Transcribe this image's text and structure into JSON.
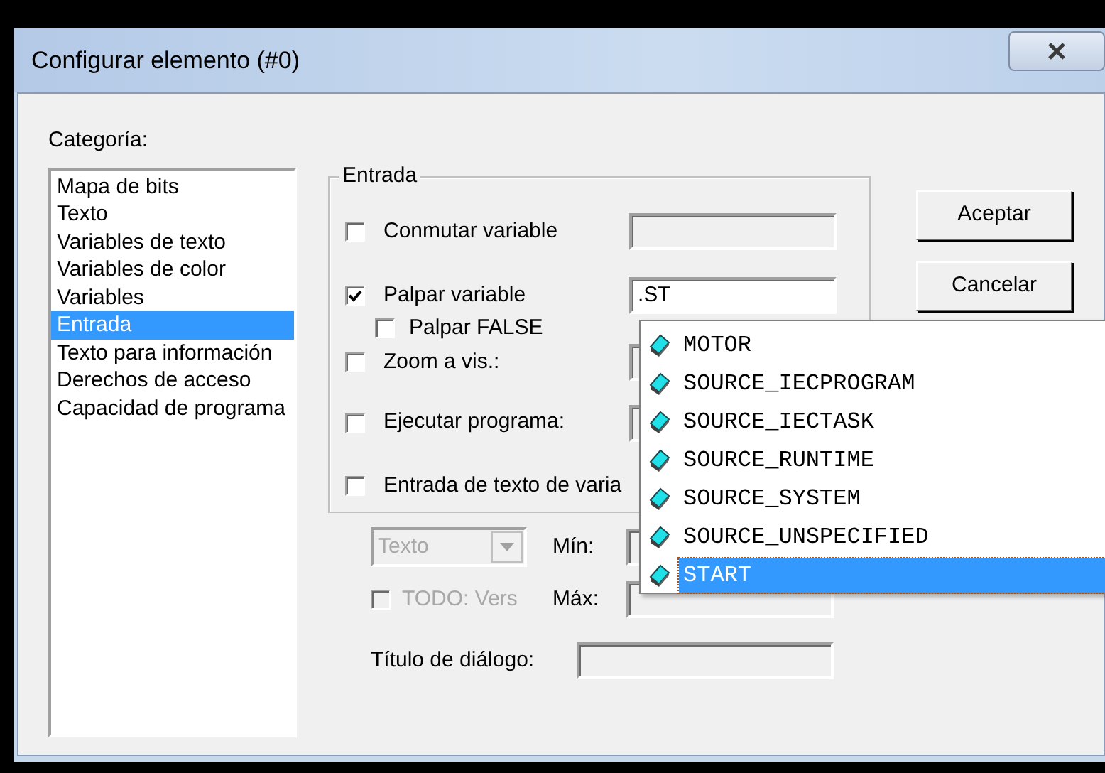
{
  "window": {
    "title": "Configurar elemento (#0)"
  },
  "category_label": "Categoría:",
  "categories": [
    {
      "label": "Mapa de bits",
      "selected": false
    },
    {
      "label": "Texto",
      "selected": false
    },
    {
      "label": "Variables de texto",
      "selected": false
    },
    {
      "label": "Variables de color",
      "selected": false
    },
    {
      "label": "Variables",
      "selected": false
    },
    {
      "label": "Entrada",
      "selected": true
    },
    {
      "label": "Texto para información",
      "selected": false
    },
    {
      "label": "Derechos de acceso",
      "selected": false
    },
    {
      "label": "Capacidad de programa",
      "selected": false
    }
  ],
  "group": {
    "title": "Entrada",
    "options": [
      {
        "kind": "checkbox",
        "label": "Conmutar variable",
        "checked": false,
        "has_field": true
      },
      {
        "kind": "checkbox",
        "label": "Palpar variable",
        "checked": true,
        "has_field": true,
        "value": ".ST"
      },
      {
        "kind": "sub_checkbox",
        "label": "Palpar FALSE",
        "checked": false
      },
      {
        "kind": "checkbox",
        "label": "Zoom a vis.:",
        "checked": false,
        "has_field": true
      },
      {
        "kind": "checkbox",
        "label": "Ejecutar programa:",
        "checked": false,
        "has_field": true
      },
      {
        "kind": "checkbox",
        "label": "Entrada de texto de varia",
        "checked": false
      }
    ]
  },
  "type_select": {
    "value": "Texto",
    "disabled": true
  },
  "min_label": "Mín:",
  "todo": {
    "label": "TODO: Vers",
    "checked": false,
    "disabled": true
  },
  "max_label": "Máx:",
  "dialog_title_label": "Título de diálogo:",
  "buttons": [
    "Aceptar",
    "Cancelar"
  ],
  "autocomplete": {
    "items": [
      {
        "label": "MOTOR",
        "selected": false
      },
      {
        "label": "SOURCE_IECPROGRAM",
        "selected": false
      },
      {
        "label": "SOURCE_IECTASK",
        "selected": false
      },
      {
        "label": "SOURCE_RUNTIME",
        "selected": false
      },
      {
        "label": "SOURCE_SYSTEM",
        "selected": false
      },
      {
        "label": "SOURCE_UNSPECIFIED",
        "selected": false
      },
      {
        "label": "START",
        "selected": true
      }
    ]
  }
}
